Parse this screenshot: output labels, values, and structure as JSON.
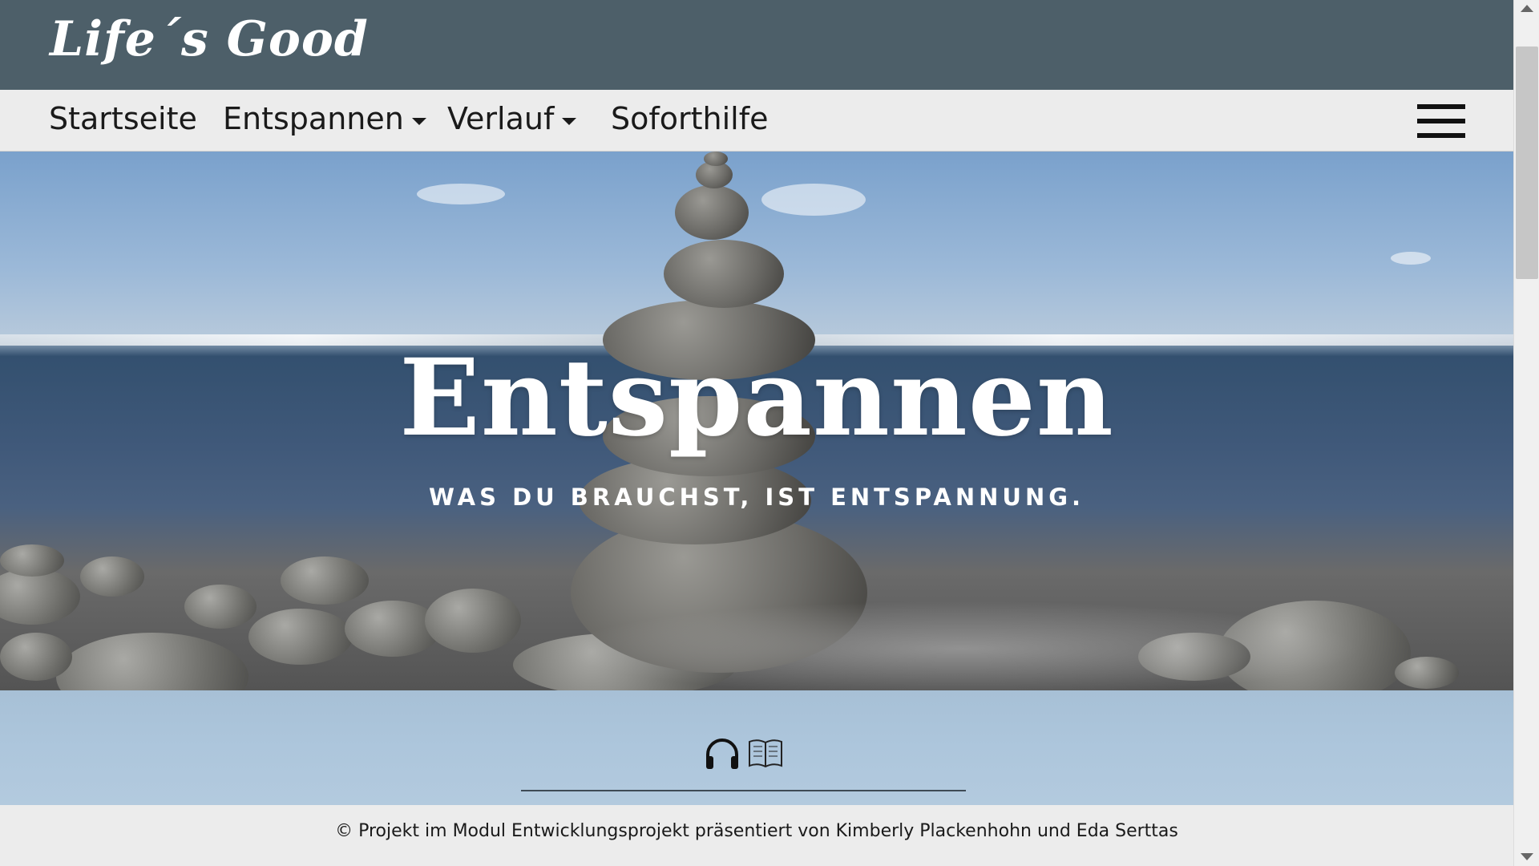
{
  "brand": {
    "name": "Life´s Good"
  },
  "nav": {
    "items": [
      {
        "label": "Startseite",
        "has_dropdown": false
      },
      {
        "label": "Entspannen",
        "has_dropdown": true
      },
      {
        "label": "Verlauf",
        "has_dropdown": true
      },
      {
        "label": "Soforthilfe",
        "has_dropdown": false
      }
    ],
    "menu_icon": "hamburger-menu-icon"
  },
  "hero": {
    "title": "Entspannen",
    "subtitle": "WAS DU BRAUCHST, IST ENTSPANNUNG."
  },
  "content": {
    "icons": [
      "headphones-icon",
      "book-icon"
    ]
  },
  "footer": {
    "text": "© Projekt im Modul Entwicklungsprojekt präsentiert von Kimberly Plackenhohn und Eda Serttas"
  },
  "colors": {
    "brand_bar": "#4d5f69",
    "nav_bg": "#ececec",
    "content_bg": "#adc6dc",
    "text": "#1a1a1a"
  }
}
